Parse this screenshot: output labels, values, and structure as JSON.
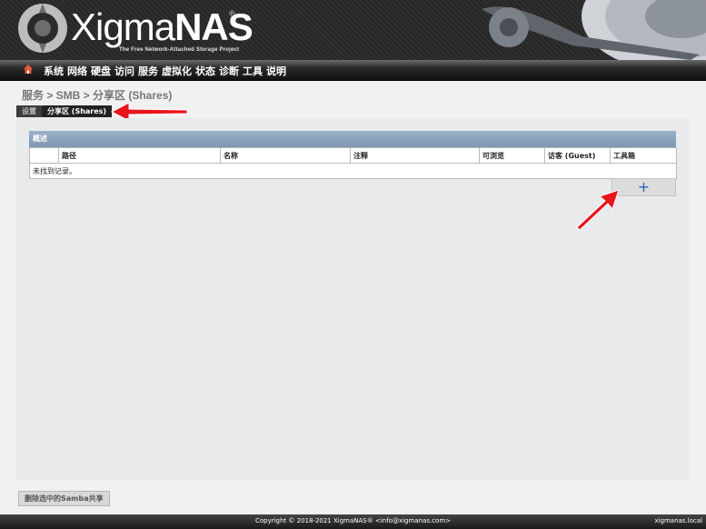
{
  "header": {
    "logo_text_1": "Xigma",
    "logo_text_2": "NAS",
    "logo_reg": "®",
    "tagline": "The Free Network-Attached Storage Project"
  },
  "nav": {
    "items": [
      "系统",
      "网络",
      "硬盘",
      "访问",
      "服务",
      "虚拟化",
      "状态",
      "诊断",
      "工具",
      "说明"
    ]
  },
  "breadcrumb": "服务 > SMB > 分享区 (Shares)",
  "tabs": [
    "设置",
    "分享区 (Shares)"
  ],
  "section": {
    "title": "概述",
    "columns": [
      "",
      "路径",
      "名称",
      "注释",
      "可浏览",
      "访客 (Guest)",
      "工具箱"
    ],
    "empty_message": "未找到记录。"
  },
  "add_icon": "plus-icon",
  "delete_button": "删除选中的Samba共享",
  "footer": {
    "copyright": "Copyright © 2018-2021 XigmaNAS® <info@xigmanas.com>",
    "hostname": "xigmanas.local"
  },
  "colors": {
    "header_bg": "#2b2b2b",
    "section_header": "#8aa3bd",
    "annotation_arrow": "#e8141b",
    "add_icon": "#2a63b8"
  }
}
